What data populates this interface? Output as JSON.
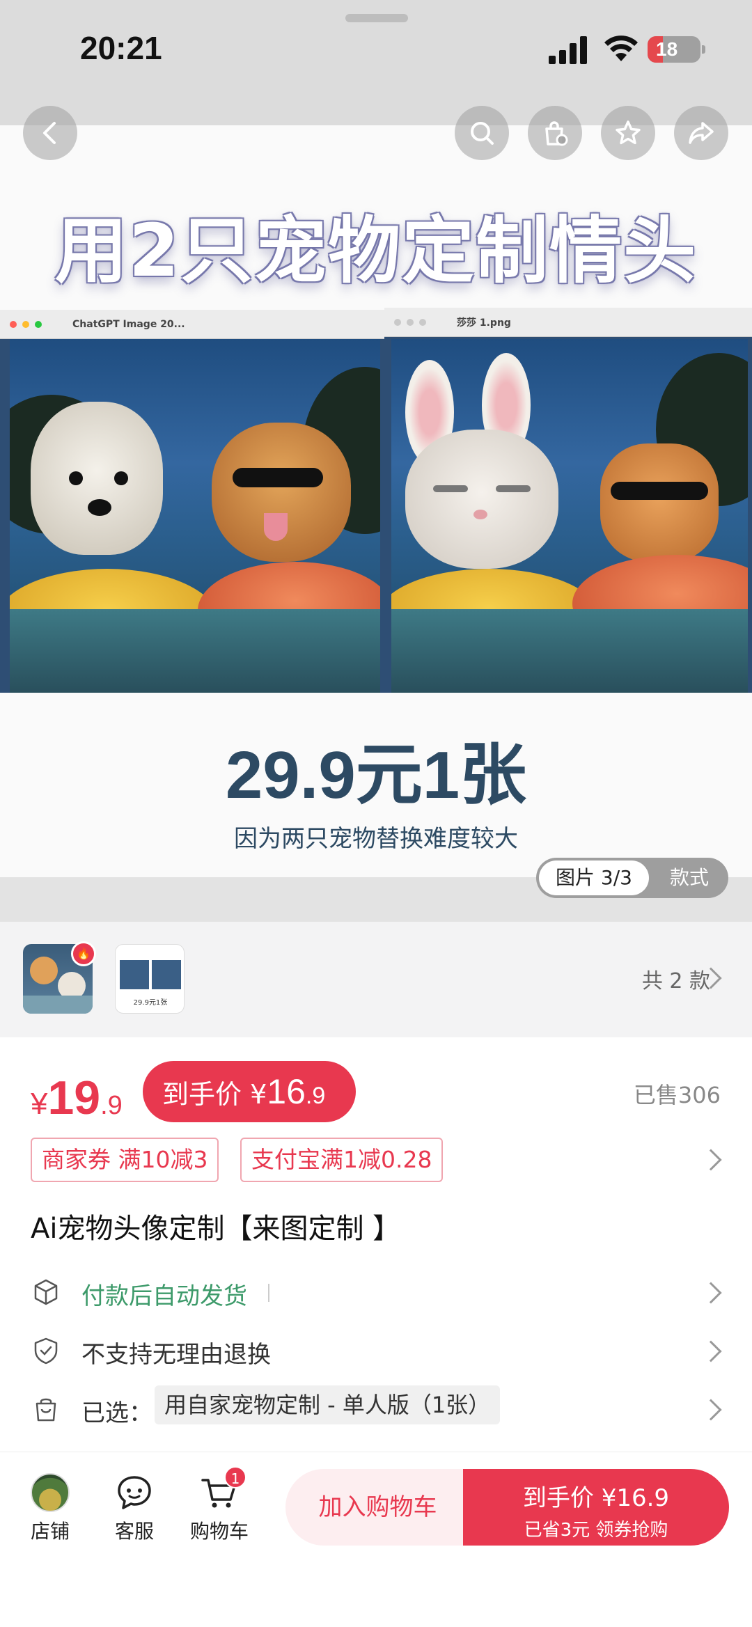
{
  "status": {
    "time": "20:21",
    "battery": "18"
  },
  "hero": {
    "title": "用2只宠物定制情头",
    "left_window_name": "ChatGPT Image 20...",
    "right_window_name": "莎莎 1.png",
    "price_headline": "29.9元1张",
    "price_note": "因为两只宠物替换难度较大",
    "pager_current": "图片 3/3",
    "pager_alt": "款式"
  },
  "styles": {
    "count_label": "共 2 款",
    "thumb2_caption": "29.9元1张"
  },
  "price": {
    "currency": "¥",
    "integer": "19",
    "decimal": ".9",
    "hand_label": "到手价 ¥",
    "hand_integer": "16",
    "hand_decimal": ".9",
    "sold": "已售306"
  },
  "coupons": [
    "商家券 满10减3",
    "支付宝满1减0.28"
  ],
  "product_title": "Ai宠物头像定制【来图定制 】",
  "services": {
    "shipping": "付款后自动发货",
    "returns": "不支持无理由退换",
    "selected_label": "已选：",
    "selected_value": "用自家宠物定制 - 单人版（1张）"
  },
  "bottom": {
    "shop": "店铺",
    "service": "客服",
    "cart": "购物车",
    "cart_badge": "1",
    "add_to_cart": "加入购物车",
    "buy_line1": "到手价 ¥16.9",
    "buy_line2": "已省3元 领券抢购"
  },
  "colors": {
    "accent": "#e8384f",
    "shipping_green": "#3d9a6a",
    "price_text": "#2d4a63"
  }
}
